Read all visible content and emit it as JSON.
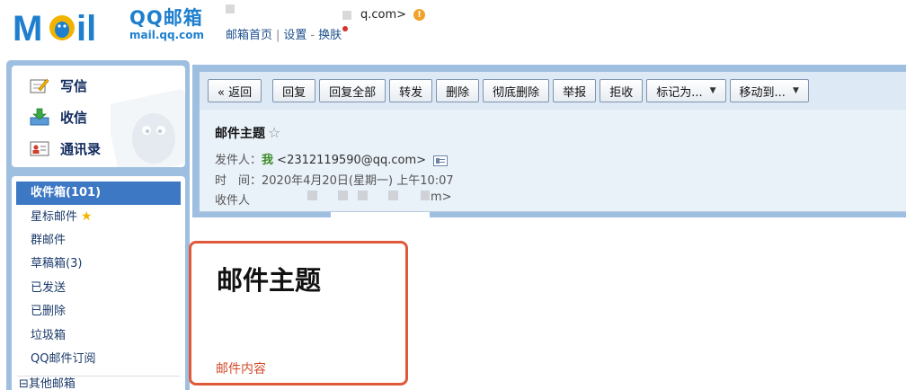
{
  "header": {
    "logo_cn": "QQ邮箱",
    "logo_url": "mail.qq.com",
    "account_suffix": "q.com>",
    "warning_glyph": "!",
    "links": {
      "home": "邮箱首页",
      "settings": "设置",
      "dash": "-",
      "skin": "换肤"
    }
  },
  "sidebar": {
    "actions": [
      {
        "label": "写信",
        "icon": "compose-icon"
      },
      {
        "label": "收信",
        "icon": "inbox-download-icon"
      },
      {
        "label": "通讯录",
        "icon": "contacts-icon"
      }
    ],
    "folders": [
      {
        "label": "收件箱(101)",
        "active": true
      },
      {
        "label": "星标邮件",
        "star": "★"
      },
      {
        "label": "群邮件"
      },
      {
        "label": "草稿箱(3)"
      },
      {
        "label": "已发送"
      },
      {
        "label": "已删除"
      },
      {
        "label": "垃圾箱"
      },
      {
        "label": "QQ邮件订阅"
      }
    ],
    "other_folders": "⊟其他邮箱"
  },
  "toolbar": {
    "back": "« 返回",
    "reply": "回复",
    "reply_all": "回复全部",
    "forward": "转发",
    "delete": "删除",
    "delete_perm": "彻底删除",
    "report": "举报",
    "reject": "拒收",
    "mark_as": "标记为...",
    "move_to": "移动到...",
    "caret": "▼"
  },
  "mail": {
    "subject": "邮件主题",
    "subject_star": "☆",
    "sender_label": "发件人：",
    "sender_name": "我",
    "sender_addr": "<2312119590@qq.com>",
    "time_label": "时　间：",
    "time_value": "2020年4月20日(星期一) 上午10:07",
    "recipient_label": "收件人",
    "recipient_tail": "m>",
    "body_title": "邮件主题",
    "body_text": "邮件内容"
  },
  "colors": {
    "brand_blue": "#1e7fce",
    "frame_blue": "#9fbfe1",
    "active_folder": "#3d78c4",
    "highlight_border": "#e05a3a",
    "body_text": "#d34a2a"
  }
}
